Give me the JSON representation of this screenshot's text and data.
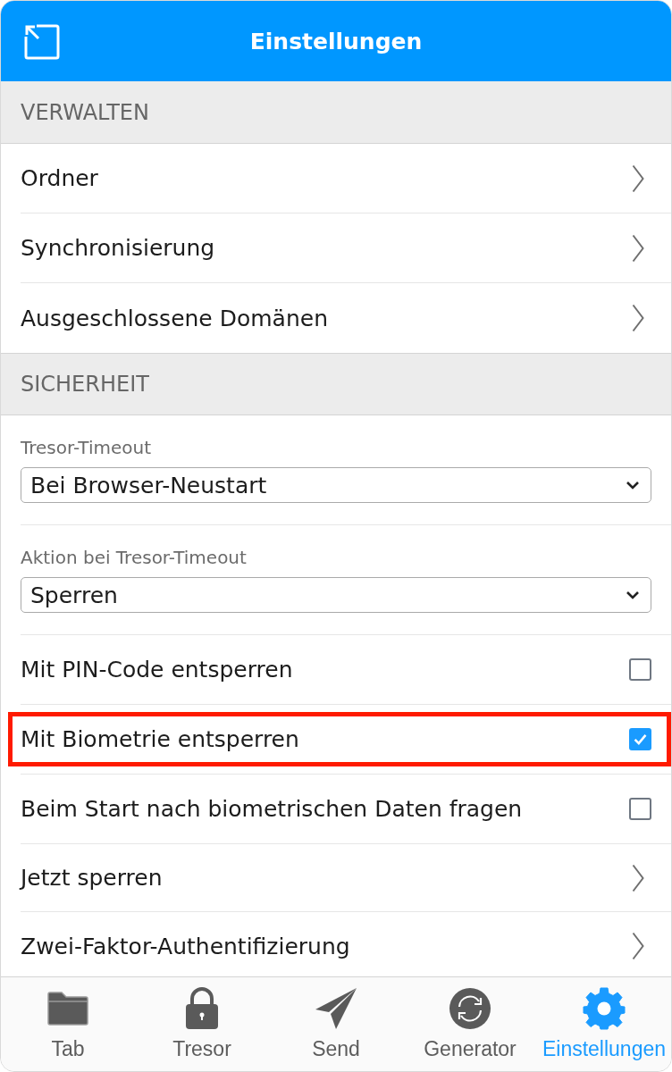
{
  "header": {
    "title": "Einstellungen"
  },
  "sections": [
    {
      "title": "VERWALTEN",
      "items": [
        {
          "kind": "link",
          "label": "Ordner",
          "highlighted": false
        },
        {
          "kind": "link",
          "label": "Synchronisierung",
          "highlighted": false
        },
        {
          "kind": "link",
          "label": "Ausgeschlossene Domänen",
          "highlighted": false
        }
      ]
    },
    {
      "title": "SICHERHEIT",
      "items": [
        {
          "kind": "select",
          "label": "Tresor-Timeout",
          "value": "Bei Browser-Neustart",
          "highlighted": false
        },
        {
          "kind": "select",
          "label": "Aktion bei Tresor-Timeout",
          "value": "Sperren",
          "highlighted": false
        },
        {
          "kind": "checkbox",
          "label": "Mit PIN-Code entsperren",
          "checked": false,
          "highlighted": false
        },
        {
          "kind": "checkbox",
          "label": "Mit Biometrie entsperren",
          "checked": true,
          "highlighted": true
        },
        {
          "kind": "checkbox",
          "label": "Beim Start nach biometrischen Daten fragen",
          "checked": false,
          "highlighted": false
        },
        {
          "kind": "link",
          "label": "Jetzt sperren",
          "highlighted": false
        },
        {
          "kind": "link",
          "label": "Zwei-Faktor-Authentifizierung",
          "highlighted": false
        }
      ]
    }
  ],
  "tabs": [
    {
      "label": "Tab",
      "selected": false
    },
    {
      "label": "Tresor",
      "selected": false
    },
    {
      "label": "Send",
      "selected": false
    },
    {
      "label": "Generator",
      "selected": false
    },
    {
      "label": "Einstellungen",
      "selected": true
    }
  ]
}
